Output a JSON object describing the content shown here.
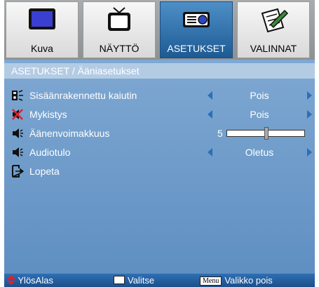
{
  "tabs": [
    {
      "label": "Kuva",
      "icon": "monitor-icon"
    },
    {
      "label": "NÄYTTÖ",
      "icon": "tv-icon"
    },
    {
      "label": "ASETUKSET",
      "icon": "projector-icon"
    },
    {
      "label": "VALINNAT",
      "icon": "notepad-pencil-icon"
    }
  ],
  "panel": {
    "title": "ASETUKSET / Ääniasetukset",
    "rows": [
      {
        "label": "Sisäänrakennettu kaiutin",
        "value": "Pois",
        "icon": "speaker-icon"
      },
      {
        "label": "Mykistys",
        "value": "Pois",
        "icon": "mute-icon"
      },
      {
        "label": "Äänenvoimakkuus",
        "value": "5",
        "slider_fraction": 0.5,
        "icon": "volume-icon"
      },
      {
        "label": "Audiotulo",
        "value": "Oletus",
        "icon": "audio-input-icon"
      },
      {
        "label": "Lopeta",
        "icon": "exit-icon"
      }
    ]
  },
  "footer": {
    "updown": "YlösAlas",
    "select": "Valitse",
    "menu_key": "Menu",
    "menu": "Valikko pois"
  },
  "colors": {
    "accent": "#2c6fb6",
    "panel": "#6f9ccb",
    "active_tab": "#2f6fb3"
  }
}
